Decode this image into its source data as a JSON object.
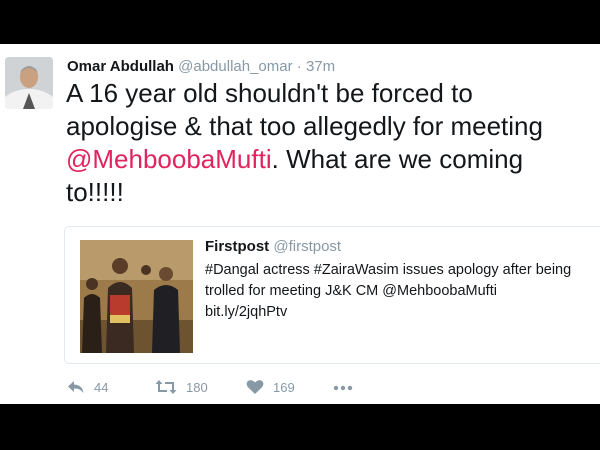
{
  "tweet": {
    "author_name": "Omar Abdullah",
    "author_handle": "@abdullah_omar",
    "separator": "·",
    "time": "37m",
    "text": {
      "line1": "A 16 year old shouldn't be forced to",
      "line2": "apologise & that too allegedly for meeting",
      "mention": "@MehboobaMufti",
      "line3_rest": ". What are we coming",
      "line4": "to!!!!!"
    }
  },
  "quoted_tweet": {
    "author_name": "Firstpost",
    "author_handle": "@firstpost",
    "lines": [
      "#Dangal actress #ZairaWasim issues apology after being",
      "trolled for meeting J&K CM @MehboobaMufti",
      "bit.ly/2jqhPtv"
    ]
  },
  "actions": {
    "reply_count": "44",
    "retweet_count": "180",
    "like_count": "169"
  },
  "colors": {
    "mention": "#e0245e",
    "muted": "#8899a6",
    "text": "#14171a",
    "background": "#ffffff"
  },
  "icons": [
    "reply-icon",
    "retweet-icon",
    "heart-icon",
    "more-icon"
  ]
}
